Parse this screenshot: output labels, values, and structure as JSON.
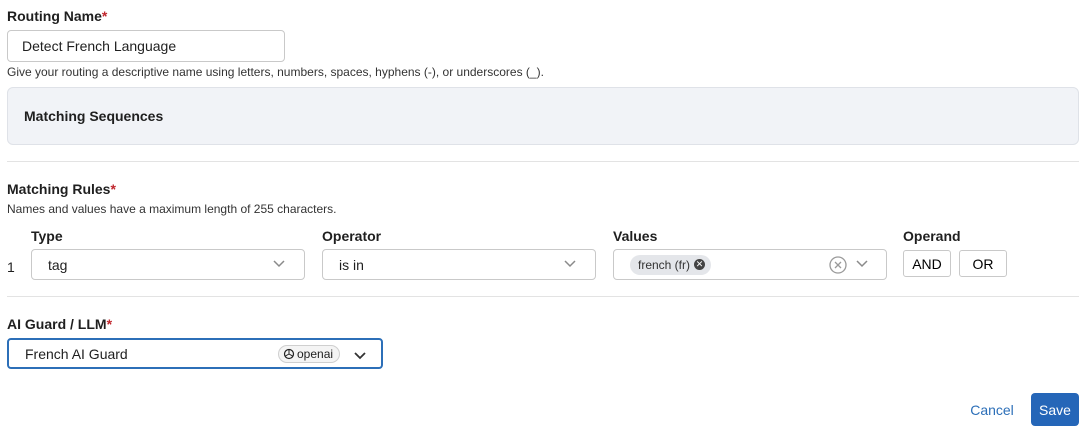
{
  "routing_name": {
    "label": "Routing Name",
    "required_mark": "*",
    "value": "Detect French Language",
    "help": "Give your routing a descriptive name using letters, numbers, spaces, hyphens (-), or underscores (_)."
  },
  "matching_sequences": {
    "title": "Matching Sequences"
  },
  "matching_rules": {
    "label": "Matching Rules",
    "required_mark": "*",
    "help": "Names and values have a maximum length of 255 characters.",
    "columns": {
      "type": "Type",
      "operator": "Operator",
      "values": "Values",
      "operand": "Operand"
    },
    "rows": [
      {
        "index": "1",
        "type": "tag",
        "operator": "is in",
        "values": [
          "french (fr)"
        ],
        "operands": [
          "AND",
          "OR"
        ]
      }
    ]
  },
  "ai_guard": {
    "label": "AI Guard / LLM",
    "required_mark": "*",
    "value": "French AI Guard",
    "provider": "openai",
    "provider_icon": "openai-logo-icon"
  },
  "actions": {
    "cancel": "Cancel",
    "save": "Save"
  },
  "colors": {
    "accent": "#2566b8",
    "required": "#c0262d",
    "panel_bg": "#f1f3f7"
  }
}
